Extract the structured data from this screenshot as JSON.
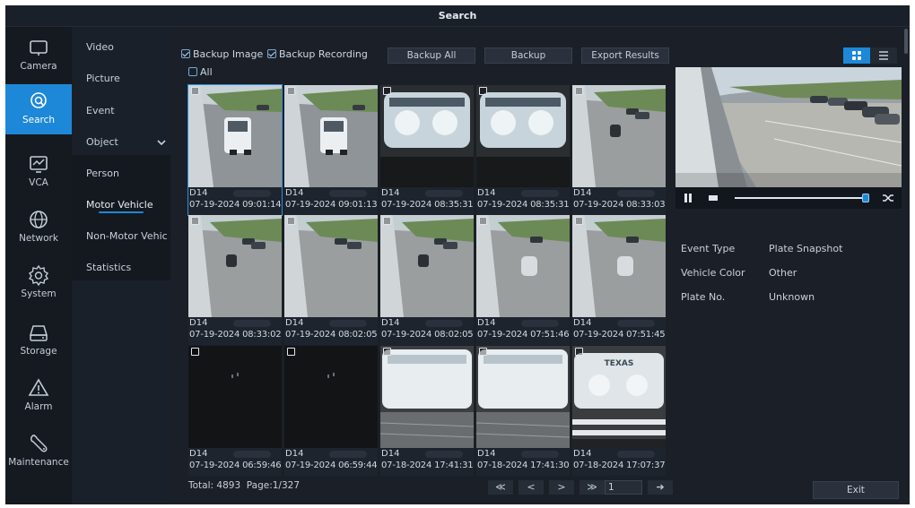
{
  "window": {
    "title": "Search"
  },
  "left_nav": [
    {
      "label": "Camera",
      "icon": "camera-icon"
    },
    {
      "label": "Search",
      "icon": "search-icon",
      "active": true
    },
    {
      "label": "VCA",
      "icon": "vca-icon"
    },
    {
      "label": "Network",
      "icon": "globe-icon"
    },
    {
      "label": "System",
      "icon": "gear-icon"
    },
    {
      "label": "Storage",
      "icon": "storage-icon"
    },
    {
      "label": "Alarm",
      "icon": "alarm-icon"
    },
    {
      "label": "Maintenance",
      "icon": "wrench-icon"
    }
  ],
  "sub_nav": {
    "video": "Video",
    "picture": "Picture",
    "event": "Event",
    "object": "Object",
    "person": "Person",
    "motor_vehicle": "Motor Vehicle",
    "non_motor_vehicle": "Non-Motor Vehic..",
    "statistics": "Statistics"
  },
  "toolbar": {
    "backup_image": "Backup Image",
    "backup_recording": "Backup Recording",
    "backup_all": "Backup All",
    "backup": "Backup",
    "export_results": "Export Results",
    "select_all": "All"
  },
  "results": [
    {
      "camera": "D14",
      "time": "07-19-2024 09:01:14",
      "scene": "van",
      "selected": true
    },
    {
      "camera": "D14",
      "time": "07-19-2024 09:01:13",
      "scene": "van"
    },
    {
      "camera": "D14",
      "time": "07-19-2024 08:35:31",
      "scene": "plate-close"
    },
    {
      "camera": "D14",
      "time": "07-19-2024 08:35:31",
      "scene": "plate-close"
    },
    {
      "camera": "D14",
      "time": "07-19-2024 08:33:03",
      "scene": "lot-car"
    },
    {
      "camera": "D14",
      "time": "07-19-2024 08:33:02",
      "scene": "lot-car"
    },
    {
      "camera": "D14",
      "time": "07-19-2024 08:02:05",
      "scene": "lot"
    },
    {
      "camera": "D14",
      "time": "07-19-2024 08:02:05",
      "scene": "lot-car"
    },
    {
      "camera": "D14",
      "time": "07-19-2024 07:51:46",
      "scene": "lot-silver"
    },
    {
      "camera": "D14",
      "time": "07-19-2024 07:51:45",
      "scene": "lot-silver"
    },
    {
      "camera": "D14",
      "time": "07-19-2024 06:59:46",
      "scene": "night"
    },
    {
      "camera": "D14",
      "time": "07-19-2024 06:59:44",
      "scene": "night"
    },
    {
      "camera": "D14",
      "time": "07-18-2024 17:41:31",
      "scene": "plate-bright"
    },
    {
      "camera": "D14",
      "time": "07-18-2024 17:41:30",
      "scene": "plate-bright"
    },
    {
      "camera": "D14",
      "time": "07-18-2024 17:07:37",
      "scene": "plate-texas",
      "plate_text": "TEXAS"
    }
  ],
  "pagination": {
    "summary": "Total: 4893  Page:1/327",
    "first": "≪",
    "prev": "<",
    "next": ">",
    "last": "≫",
    "page_input": "1",
    "go": "➔"
  },
  "details": {
    "event_type_label": "Event Type",
    "event_type_value": "Plate Snapshot",
    "vehicle_color_label": "Vehicle Color",
    "vehicle_color_value": "Other",
    "plate_no_label": "Plate No.",
    "plate_no_value": "Unknown"
  },
  "player": {
    "progress": 1.0
  },
  "exit_label": "Exit",
  "colors": {
    "accent": "#1e88d8",
    "background": "#1b2028",
    "nav_bg": "#151a21"
  }
}
